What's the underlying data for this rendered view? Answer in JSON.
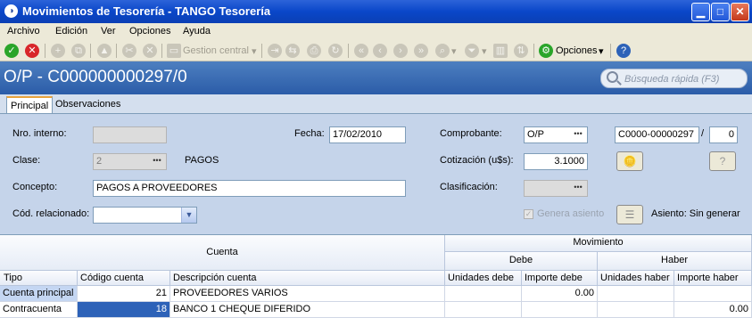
{
  "window": {
    "title": "Movimientos de Tesorería - TANGO Tesorería"
  },
  "menu": {
    "items": [
      "Archivo",
      "Edición",
      "Ver",
      "Opciones",
      "Ayuda"
    ]
  },
  "toolbar": {
    "gestion_central": "Gestion central",
    "opciones": "Opciones"
  },
  "header": {
    "document_title": "O/P - C000000000297/0"
  },
  "search": {
    "placeholder": "Búsqueda rápida (F3)"
  },
  "tabs": {
    "principal": "Principal",
    "observaciones": "Observaciones"
  },
  "form": {
    "nro_interno_label": "Nro. interno:",
    "nro_interno_value": "",
    "fecha_label": "Fecha:",
    "fecha_value": "17/02/2010",
    "comprobante_label": "Comprobante:",
    "comprobante_tipo": "O/P",
    "comprobante_numero": "C0000-00000297",
    "comprobante_sep": "/",
    "comprobante_sufijo": "0",
    "clase_label": "Clase:",
    "clase_value": "2",
    "clase_desc": "PAGOS",
    "cotizacion_label": "Cotización (u$s):",
    "cotizacion_value": "3.1000",
    "concepto_label": "Concepto:",
    "concepto_value": "PAGOS A PROVEEDORES",
    "clasificacion_label": "Clasificación:",
    "cod_relacionado_label": "Cód. relacionado:",
    "genera_asiento_label": "Genera asiento",
    "asiento_label": "Asiento: Sin generar"
  },
  "grid": {
    "group_cuenta": "Cuenta",
    "group_movimiento": "Movimiento",
    "group_debe": "Debe",
    "group_haber": "Haber",
    "columns": [
      "Tipo",
      "Código cuenta",
      "Descripción cuenta",
      "Unidades debe",
      "Importe debe",
      "Unidades haber",
      "Importe haber"
    ],
    "rows": [
      {
        "tipo": "Cuenta principal",
        "codigo": "21",
        "descripcion": "PROVEEDORES VARIOS",
        "unidades_debe": "",
        "importe_debe": "0.00",
        "unidades_haber": "",
        "importe_haber": ""
      },
      {
        "tipo": "Contracuenta",
        "codigo": "18",
        "descripcion": "BANCO 1 CHEQUE DIFERIDO",
        "unidades_debe": "",
        "importe_debe": "",
        "unidades_haber": "",
        "importe_haber": "0.00"
      }
    ]
  }
}
